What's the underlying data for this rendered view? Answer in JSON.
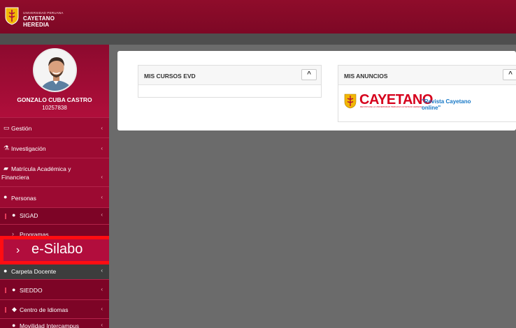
{
  "header": {
    "university_small": "UNIVERSIDAD PERUANA",
    "university_name": "CAYETANO HEREDIA"
  },
  "profile": {
    "name": "GONZALO CUBA CASTRO",
    "code": "10257838"
  },
  "sidebar": {
    "items": [
      {
        "label": "Gestión",
        "icon": "laptop-icon"
      },
      {
        "label": "Investigación",
        "icon": "flask-icon"
      },
      {
        "label": "Matrícula Académica y",
        "label2": "Financiera",
        "icon": "book-icon"
      },
      {
        "label": "Personas",
        "icon": "user-icon"
      },
      {
        "label": "SIGAD",
        "icon": "user-icon"
      },
      {
        "label": "Programas",
        "icon": "chevron-right-icon"
      },
      {
        "label": "e-Silabo",
        "icon": "chevron-right-icon"
      },
      {
        "label": "Carpeta Docente",
        "icon": "user-icon"
      },
      {
        "label": "SIEDDO",
        "icon": "user-icon"
      },
      {
        "label": "Centro de Idiomas",
        "icon": "chat-icon"
      },
      {
        "label": "Movilidad Intercampus",
        "icon": "user-icon"
      }
    ]
  },
  "main": {
    "panels": [
      {
        "title": "MIS CURSOS EVD",
        "collapse": "^"
      },
      {
        "title": "MIS ANUNCIOS",
        "collapse": "^"
      }
    ],
    "announcement": {
      "brand": "CAYETANO",
      "brand_sub": "REVISTA DE LA UNIVERSIDAD PERUANA CAYETANO HEREDIA",
      "link_text": "\"Revista Cayetano online\""
    }
  },
  "colors": {
    "topbar": "#8f0c2b",
    "sidebar": "#9c0a32",
    "highlight_border": "#ff0d12",
    "link": "#1577c6",
    "brand_red": "#d6001c"
  }
}
